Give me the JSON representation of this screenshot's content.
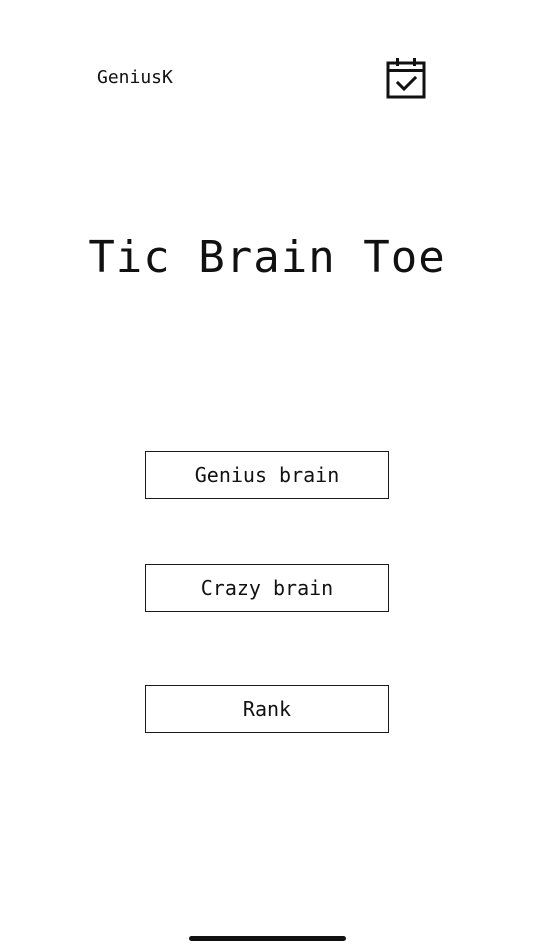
{
  "header": {
    "username": "GeniusK",
    "calendar_icon": "calendar-check-icon"
  },
  "main": {
    "title": "Tic Brain Toe",
    "buttons": [
      {
        "label": "Genius brain"
      },
      {
        "label": "Crazy brain"
      },
      {
        "label": "Rank"
      }
    ]
  },
  "colors": {
    "background": "#ffffff",
    "foreground": "#111111"
  }
}
